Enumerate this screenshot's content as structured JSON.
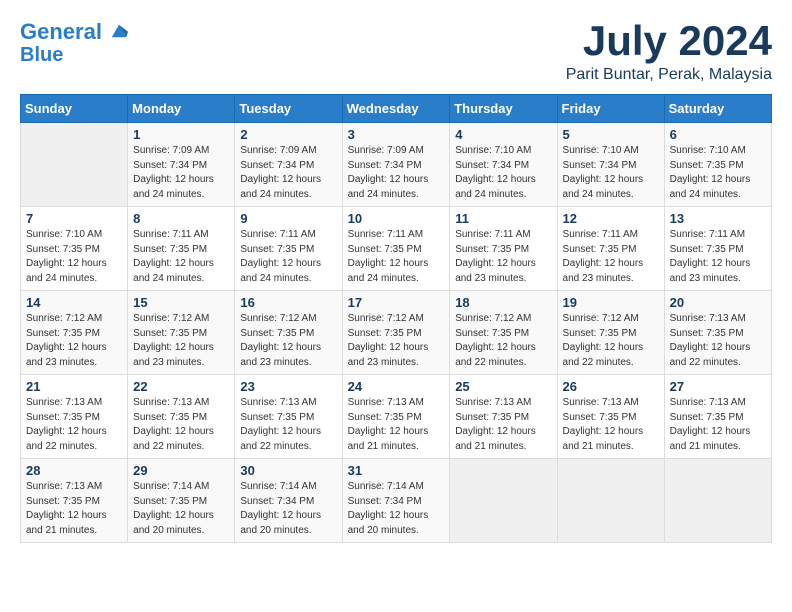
{
  "logo": {
    "line1": "General",
    "line2": "Blue"
  },
  "title": "July 2024",
  "subtitle": "Parit Buntar, Perak, Malaysia",
  "weekdays": [
    "Sunday",
    "Monday",
    "Tuesday",
    "Wednesday",
    "Thursday",
    "Friday",
    "Saturday"
  ],
  "weeks": [
    [
      {
        "day": "",
        "sunrise": "",
        "sunset": "",
        "daylight": ""
      },
      {
        "day": "1",
        "sunrise": "7:09 AM",
        "sunset": "7:34 PM",
        "daylight": "12 hours and 24 minutes."
      },
      {
        "day": "2",
        "sunrise": "7:09 AM",
        "sunset": "7:34 PM",
        "daylight": "12 hours and 24 minutes."
      },
      {
        "day": "3",
        "sunrise": "7:09 AM",
        "sunset": "7:34 PM",
        "daylight": "12 hours and 24 minutes."
      },
      {
        "day": "4",
        "sunrise": "7:10 AM",
        "sunset": "7:34 PM",
        "daylight": "12 hours and 24 minutes."
      },
      {
        "day": "5",
        "sunrise": "7:10 AM",
        "sunset": "7:34 PM",
        "daylight": "12 hours and 24 minutes."
      },
      {
        "day": "6",
        "sunrise": "7:10 AM",
        "sunset": "7:35 PM",
        "daylight": "12 hours and 24 minutes."
      }
    ],
    [
      {
        "day": "7",
        "sunrise": "7:10 AM",
        "sunset": "7:35 PM",
        "daylight": "12 hours and 24 minutes."
      },
      {
        "day": "8",
        "sunrise": "7:11 AM",
        "sunset": "7:35 PM",
        "daylight": "12 hours and 24 minutes."
      },
      {
        "day": "9",
        "sunrise": "7:11 AM",
        "sunset": "7:35 PM",
        "daylight": "12 hours and 24 minutes."
      },
      {
        "day": "10",
        "sunrise": "7:11 AM",
        "sunset": "7:35 PM",
        "daylight": "12 hours and 24 minutes."
      },
      {
        "day": "11",
        "sunrise": "7:11 AM",
        "sunset": "7:35 PM",
        "daylight": "12 hours and 23 minutes."
      },
      {
        "day": "12",
        "sunrise": "7:11 AM",
        "sunset": "7:35 PM",
        "daylight": "12 hours and 23 minutes."
      },
      {
        "day": "13",
        "sunrise": "7:11 AM",
        "sunset": "7:35 PM",
        "daylight": "12 hours and 23 minutes."
      }
    ],
    [
      {
        "day": "14",
        "sunrise": "7:12 AM",
        "sunset": "7:35 PM",
        "daylight": "12 hours and 23 minutes."
      },
      {
        "day": "15",
        "sunrise": "7:12 AM",
        "sunset": "7:35 PM",
        "daylight": "12 hours and 23 minutes."
      },
      {
        "day": "16",
        "sunrise": "7:12 AM",
        "sunset": "7:35 PM",
        "daylight": "12 hours and 23 minutes."
      },
      {
        "day": "17",
        "sunrise": "7:12 AM",
        "sunset": "7:35 PM",
        "daylight": "12 hours and 23 minutes."
      },
      {
        "day": "18",
        "sunrise": "7:12 AM",
        "sunset": "7:35 PM",
        "daylight": "12 hours and 22 minutes."
      },
      {
        "day": "19",
        "sunrise": "7:12 AM",
        "sunset": "7:35 PM",
        "daylight": "12 hours and 22 minutes."
      },
      {
        "day": "20",
        "sunrise": "7:13 AM",
        "sunset": "7:35 PM",
        "daylight": "12 hours and 22 minutes."
      }
    ],
    [
      {
        "day": "21",
        "sunrise": "7:13 AM",
        "sunset": "7:35 PM",
        "daylight": "12 hours and 22 minutes."
      },
      {
        "day": "22",
        "sunrise": "7:13 AM",
        "sunset": "7:35 PM",
        "daylight": "12 hours and 22 minutes."
      },
      {
        "day": "23",
        "sunrise": "7:13 AM",
        "sunset": "7:35 PM",
        "daylight": "12 hours and 22 minutes."
      },
      {
        "day": "24",
        "sunrise": "7:13 AM",
        "sunset": "7:35 PM",
        "daylight": "12 hours and 21 minutes."
      },
      {
        "day": "25",
        "sunrise": "7:13 AM",
        "sunset": "7:35 PM",
        "daylight": "12 hours and 21 minutes."
      },
      {
        "day": "26",
        "sunrise": "7:13 AM",
        "sunset": "7:35 PM",
        "daylight": "12 hours and 21 minutes."
      },
      {
        "day": "27",
        "sunrise": "7:13 AM",
        "sunset": "7:35 PM",
        "daylight": "12 hours and 21 minutes."
      }
    ],
    [
      {
        "day": "28",
        "sunrise": "7:13 AM",
        "sunset": "7:35 PM",
        "daylight": "12 hours and 21 minutes."
      },
      {
        "day": "29",
        "sunrise": "7:14 AM",
        "sunset": "7:35 PM",
        "daylight": "12 hours and 20 minutes."
      },
      {
        "day": "30",
        "sunrise": "7:14 AM",
        "sunset": "7:34 PM",
        "daylight": "12 hours and 20 minutes."
      },
      {
        "day": "31",
        "sunrise": "7:14 AM",
        "sunset": "7:34 PM",
        "daylight": "12 hours and 20 minutes."
      },
      {
        "day": "",
        "sunrise": "",
        "sunset": "",
        "daylight": ""
      },
      {
        "day": "",
        "sunrise": "",
        "sunset": "",
        "daylight": ""
      },
      {
        "day": "",
        "sunrise": "",
        "sunset": "",
        "daylight": ""
      }
    ]
  ]
}
